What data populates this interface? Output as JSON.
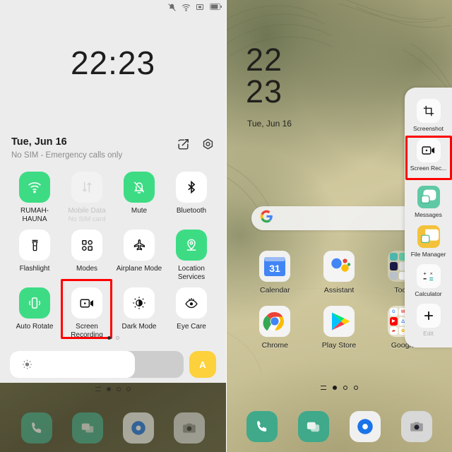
{
  "colors": {
    "accent_green": "#3ddc84",
    "highlight_red": "#ff0000",
    "auto_brightness_yellow": "#fcd13c",
    "panel_bg": "#ececec",
    "wallpaper_base": "#cdc59a"
  },
  "left_panel": {
    "statusbar": {
      "icons": [
        "mute-vibrate-icon",
        "wifi-icon",
        "screenshot-icon",
        "battery-icon"
      ]
    },
    "clock": "22:23",
    "date": "Tue, Jun 16",
    "sim_status": "No SIM - Emergency calls only",
    "actions": [
      {
        "name": "edit-tiles-icon",
        "label": "Edit"
      },
      {
        "name": "settings-gear-icon",
        "label": "Settings"
      }
    ],
    "tiles": [
      {
        "icon": "wifi-icon",
        "label": "RUMAH-HAUNA",
        "sub": "",
        "state": "on"
      },
      {
        "icon": "mobile-data-icon",
        "label": "Mobile Data",
        "sub": "No SIM card",
        "state": "disabled"
      },
      {
        "icon": "mute-bell-icon",
        "label": "Mute",
        "sub": "",
        "state": "on"
      },
      {
        "icon": "bluetooth-icon",
        "label": "Bluetooth",
        "sub": "",
        "state": "off"
      },
      {
        "icon": "flashlight-icon",
        "label": "Flashlight",
        "sub": "",
        "state": "off"
      },
      {
        "icon": "modes-grid-icon",
        "label": "Modes",
        "sub": "",
        "state": "off"
      },
      {
        "icon": "airplane-icon",
        "label": "Airplane Mode",
        "sub": "",
        "state": "off"
      },
      {
        "icon": "location-pin-icon",
        "label": "Location Services",
        "sub": "",
        "state": "on"
      },
      {
        "icon": "auto-rotate-icon",
        "label": "Auto Rotate",
        "sub": "",
        "state": "on"
      },
      {
        "icon": "screen-record-icon",
        "label": "Screen Recording",
        "sub": "",
        "state": "off",
        "highlighted": true
      },
      {
        "icon": "dark-mode-icon",
        "label": "Dark Mode",
        "sub": "",
        "state": "off"
      },
      {
        "icon": "eye-care-icon",
        "label": "Eye Care",
        "sub": "",
        "state": "off"
      }
    ],
    "page_dots": {
      "count": 2,
      "active_index": 0
    },
    "brightness": {
      "icon": "brightness-sun-icon",
      "level_percent": 72,
      "auto_label": "A"
    },
    "dock": [
      {
        "icon": "phone-icon",
        "label": "Phone"
      },
      {
        "icon": "messages-icon",
        "label": "Messages"
      },
      {
        "icon": "browser-icon",
        "label": "Browser"
      },
      {
        "icon": "camera-icon",
        "label": "Camera"
      }
    ],
    "home_dots": {
      "count": 4,
      "active_index": 1
    }
  },
  "right_panel": {
    "clock_line1": "22",
    "clock_line2": "23",
    "date": "Tue, Jun 16",
    "search": {
      "icon": "google-g-icon",
      "placeholder": ""
    },
    "apps": [
      {
        "icon": "calendar-icon",
        "label": "Calendar",
        "badge": "31"
      },
      {
        "icon": "assistant-icon",
        "label": "Assistant",
        "badge": ""
      },
      {
        "icon": "folder-icon",
        "label": "Tools",
        "badge": ""
      },
      {
        "icon": "chrome-icon",
        "label": "Chrome",
        "badge": ""
      },
      {
        "icon": "play-store-icon",
        "label": "Play Store",
        "badge": ""
      },
      {
        "icon": "folder-icon",
        "label": "Google",
        "badge": ""
      }
    ],
    "page_dots": {
      "count": 4,
      "active_index": 1
    },
    "dock": [
      {
        "icon": "phone-icon",
        "label": "Phone"
      },
      {
        "icon": "messages-icon",
        "label": "Messages"
      },
      {
        "icon": "browser-icon",
        "label": "Browser"
      },
      {
        "icon": "camera-icon",
        "label": "Camera"
      }
    ],
    "floating_toolbar": [
      {
        "icon": "screenshot-crop-icon",
        "label": "Screenshot",
        "highlighted": false,
        "dim": false
      },
      {
        "icon": "screen-record-icon",
        "label": "Screen Rec...",
        "highlighted": true,
        "dim": false
      },
      {
        "icon": "messages-app-icon",
        "label": "Messages",
        "highlighted": false,
        "dim": false
      },
      {
        "icon": "file-manager-icon",
        "label": "File Manager",
        "highlighted": false,
        "dim": false
      },
      {
        "icon": "calculator-icon",
        "label": "Calculator",
        "highlighted": false,
        "dim": false
      },
      {
        "icon": "plus-add-icon",
        "label": "Edit",
        "highlighted": false,
        "dim": true
      }
    ]
  }
}
